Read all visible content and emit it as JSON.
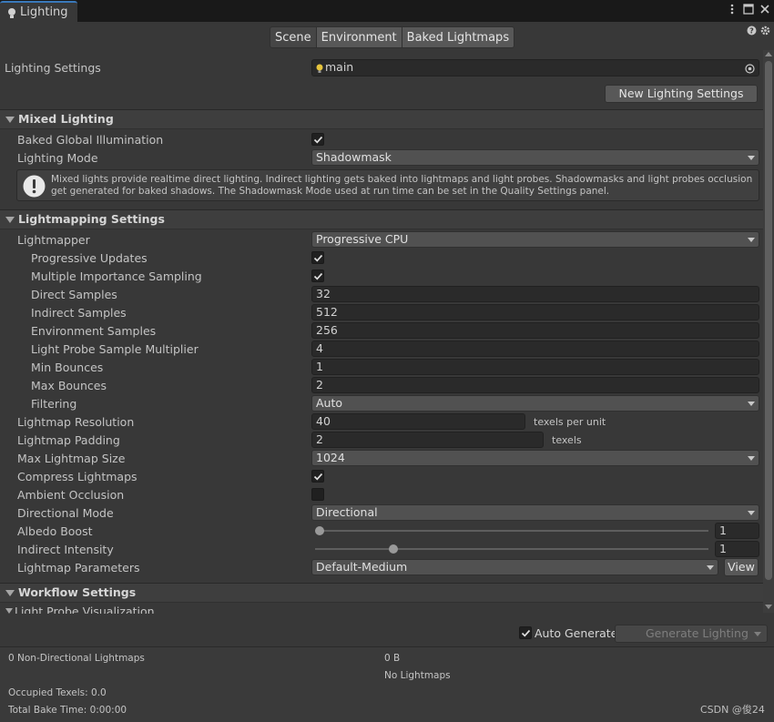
{
  "window": {
    "tab_title": "Lighting"
  },
  "tabs": [
    "Scene",
    "Environment",
    "Baked Lightmaps"
  ],
  "lighting_settings": {
    "label": "Lighting Settings",
    "value": "main",
    "new_button": "New Lighting Settings"
  },
  "mixed_lighting": {
    "header": "Mixed Lighting",
    "baked_gi_label": "Baked Global Illumination",
    "baked_gi_checked": true,
    "lighting_mode_label": "Lighting Mode",
    "lighting_mode_value": "Shadowmask",
    "info_text": "Mixed lights provide realtime direct lighting. Indirect lighting gets baked into lightmaps and light probes. Shadowmasks and light probes occlusion get generated for baked shadows. The Shadowmask Mode used at run time can be set in the Quality Settings panel."
  },
  "lightmapping": {
    "header": "Lightmapping Settings",
    "lightmapper_label": "Lightmapper",
    "lightmapper_value": "Progressive CPU",
    "progressive_updates_label": "Progressive Updates",
    "progressive_updates_checked": true,
    "mis_label": "Multiple Importance Sampling",
    "mis_checked": true,
    "direct_samples_label": "Direct Samples",
    "direct_samples_value": "32",
    "indirect_samples_label": "Indirect Samples",
    "indirect_samples_value": "512",
    "env_samples_label": "Environment Samples",
    "env_samples_value": "256",
    "probe_mult_label": "Light Probe Sample Multiplier",
    "probe_mult_value": "4",
    "min_bounces_label": "Min Bounces",
    "min_bounces_value": "1",
    "max_bounces_label": "Max Bounces",
    "max_bounces_value": "2",
    "filtering_label": "Filtering",
    "filtering_value": "Auto",
    "resolution_label": "Lightmap Resolution",
    "resolution_value": "40",
    "resolution_unit": "texels per unit",
    "padding_label": "Lightmap Padding",
    "padding_value": "2",
    "padding_unit": "texels",
    "max_size_label": "Max Lightmap Size",
    "max_size_value": "1024",
    "compress_label": "Compress Lightmaps",
    "compress_checked": true,
    "ao_label": "Ambient Occlusion",
    "ao_checked": false,
    "directional_label": "Directional Mode",
    "directional_value": "Directional",
    "albedo_label": "Albedo Boost",
    "albedo_value": "1",
    "albedo_level": 0.0,
    "indirect_int_label": "Indirect Intensity",
    "indirect_int_value": "1",
    "indirect_int_level": 0.2,
    "params_label": "Lightmap Parameters",
    "params_value": "Default-Medium",
    "view_button": "View"
  },
  "workflow": {
    "header": "Workflow Settings",
    "probe_vis": "Light Probe Visualization"
  },
  "generate": {
    "auto_label": "Auto Generate",
    "auto_checked": true,
    "button": "Generate Lighting"
  },
  "stats": {
    "non_directional": "0 Non-Directional Lightmaps",
    "size": "0 B",
    "no_lightmaps": "No Lightmaps",
    "occupied": "Occupied Texels: 0.0",
    "bake_time": "Total Bake Time: 0:00:00"
  },
  "watermark": "CSDN @俊24",
  "colors": {
    "background": "#383838",
    "field": "#2a2a2a",
    "accent": "#3a79bb"
  }
}
